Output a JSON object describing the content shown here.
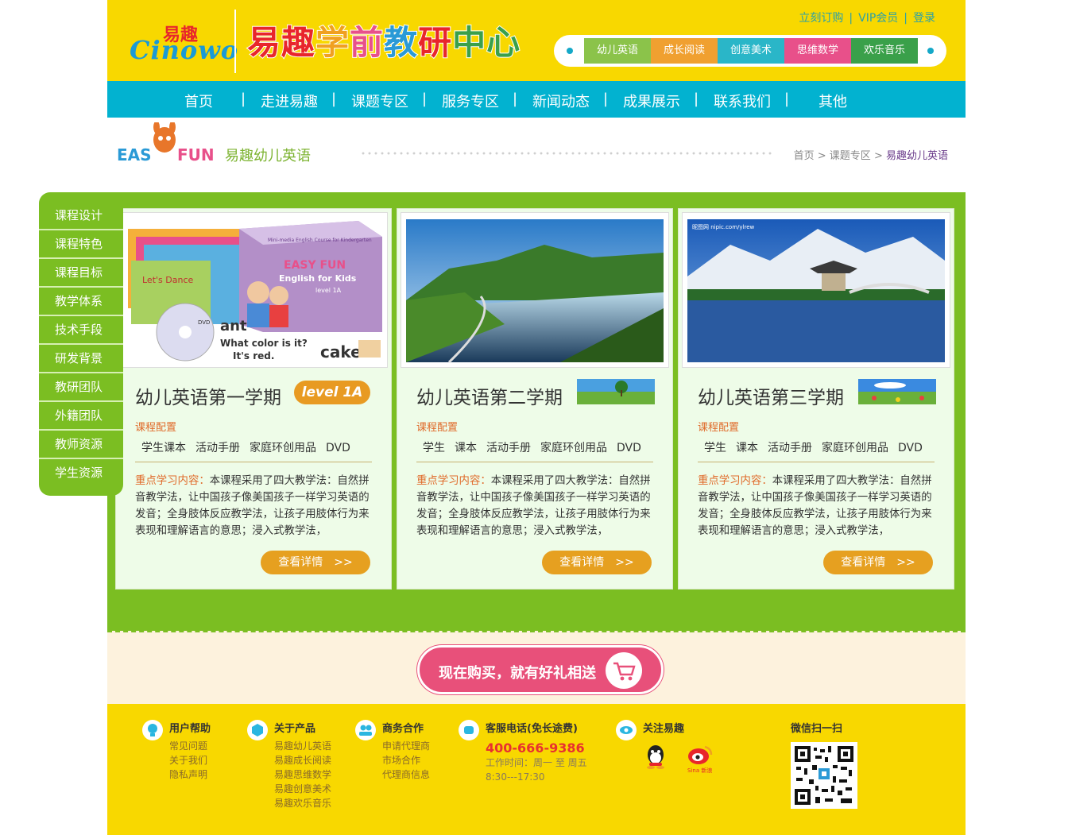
{
  "brand": {
    "logo_cn": "易趣",
    "logo_en": "Cinowo",
    "site_title": "易趣学前教研中心"
  },
  "top_links": [
    "立刻订购",
    "VIP会员",
    "登录"
  ],
  "categories": [
    {
      "label": "幼儿英语",
      "color": "#8bc34a"
    },
    {
      "label": "成长阅读",
      "color": "#f0a030"
    },
    {
      "label": "创意美术",
      "color": "#2ab6c8"
    },
    {
      "label": "思维数学",
      "color": "#e8508a"
    },
    {
      "label": "欢乐音乐",
      "color": "#3aa04a"
    }
  ],
  "nav": [
    "首页",
    "走进易趣",
    "课题专区",
    "服务专区",
    "新闻动态",
    "成果展示",
    "联系我们",
    "其他"
  ],
  "section": {
    "logo_text": "EASY FUN",
    "title": "易趣幼儿英语",
    "breadcrumb": [
      "首页",
      "课题专区",
      "易趣幼儿英语"
    ]
  },
  "side_menu": [
    "课程设计",
    "课程特色",
    "课程目标",
    "教学体系",
    "技术手段",
    "研发背景",
    "教研团队",
    "外籍团队",
    "教师资源",
    "学生资源"
  ],
  "cards": [
    {
      "title": "幼儿英语第一学期",
      "badge": "level 1A",
      "config_label": "课程配置",
      "items": [
        "学生课本",
        "活动手册",
        "家庭环创用品",
        "DVD"
      ],
      "desc_label": "重点学习内容：",
      "desc": "本课程采用了四大教学法：自然拼音教学法，让中国孩子像美国孩子一样学习英语的发音；全身肢体反应教学法，让孩子用肢体行为来表现和理解语言的意思；浸入式教学法，",
      "more": "查看详情　>>",
      "img_text": {
        "box": "EASY FUN",
        "box_sub": "English for Kids",
        "box_level": "level 1A",
        "box_top": "Mini-media English Course for Kindergarten",
        "word1": "ant",
        "q": "What color is it?",
        "a": "It's red.",
        "word2": "cake",
        "book": "Let's Dance",
        "dvd": "DVD"
      }
    },
    {
      "title": "幼儿英语第二学期",
      "config_label": "课程配置",
      "items": [
        "学生",
        "课本",
        "活动手册",
        "家庭环创用品",
        "DVD"
      ],
      "desc_label": "重点学习内容：",
      "desc": "本课程采用了四大教学法：自然拼音教学法，让中国孩子像美国孩子一样学习英语的发音；全身肢体反应教学法，让孩子用肢体行为来表现和理解语言的意思；浸入式教学法，",
      "more": "查看详情　>>"
    },
    {
      "title": "幼儿英语第三学期",
      "config_label": "课程配置",
      "items": [
        "学生",
        "课本",
        "活动手册",
        "家庭环创用品",
        "DVD"
      ],
      "desc_label": "重点学习内容：",
      "desc": "本课程采用了四大教学法：自然拼音教学法，让中国孩子像美国孩子一样学习英语的发音；全身肢体反应教学法，让孩子用肢体行为来表现和理解语言的意思；浸入式教学法，",
      "more": "查看详情　>>",
      "img_watermark": "昵图网 nipic.com/ylrew"
    }
  ],
  "promo": {
    "text": "现在购买，就有好礼相送"
  },
  "footer": {
    "help": {
      "title": "用户帮助",
      "links": [
        "常见问题",
        "关于我们",
        "隐私声明"
      ]
    },
    "products": {
      "title": "关于产品",
      "links": [
        "易趣幼儿英语",
        "易趣成长阅读",
        "易趣思维数学",
        "易趣创意美术",
        "易趣欢乐音乐"
      ]
    },
    "business": {
      "title": "商务合作",
      "links": [
        "申请代理商",
        "市场合作",
        "代理商信息"
      ]
    },
    "service": {
      "title": "客服电话(免长途费)",
      "phone": "400-666-9386",
      "hours1": "工作时间：周一 至 周五",
      "hours2": "8:30---17:30"
    },
    "follow": {
      "title": "关注易趣",
      "weibo_text": "Sina 新浪"
    },
    "wechat": {
      "title": "微信扫一扫"
    }
  }
}
